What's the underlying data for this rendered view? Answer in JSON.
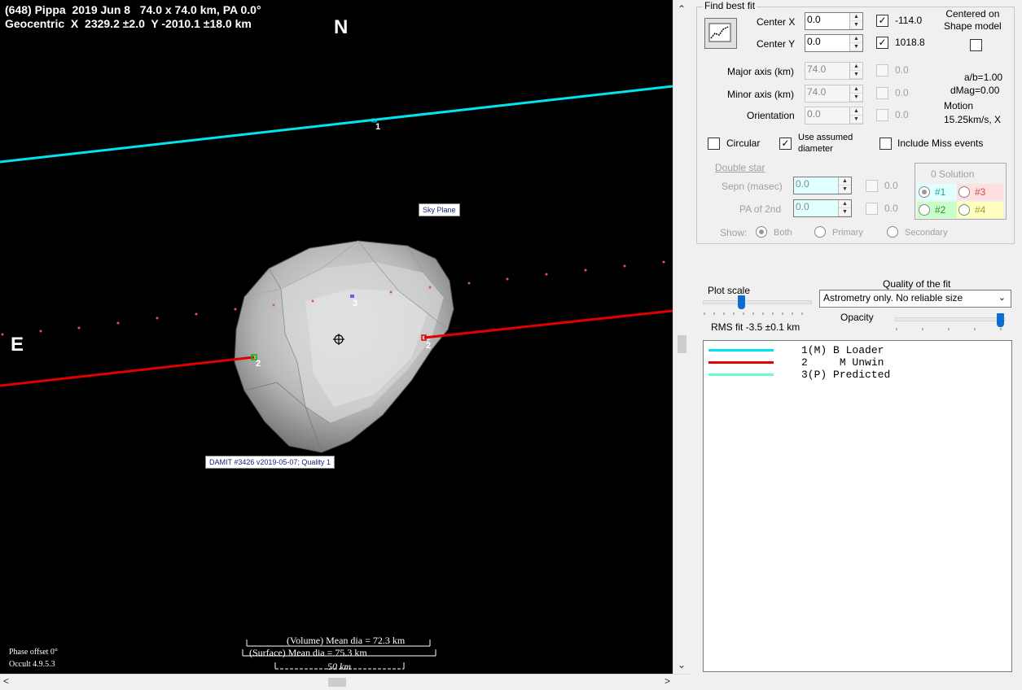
{
  "plot": {
    "header_line1": "(648) Pippa  2019 Jun 8   74.0 x 74.0 km, PA 0.0°",
    "header_line2": "Geocentric  X  2329.2 ±2.0  Y -2010.1 ±18.0 km",
    "north_label": "N",
    "east_label": "E",
    "sky_plane_label": "Sky Plane",
    "model_label": "DAMIT #3426 v2019-05-07; Quality 1",
    "chord_labels": {
      "chord1": "1",
      "chord2_left": "2",
      "chord2_right": "2",
      "chord3": "3"
    },
    "volume_dia": "(Volume) Mean dia = 72.3 km",
    "surface_dia": "(Surface) Mean dia = 75.3 km",
    "scale_label": "50 km",
    "phase_offset": "Phase offset 0°",
    "version": "Occult 4.9.5.3",
    "colors": {
      "chord1": "#00e5ee",
      "chord2": "#e00000",
      "predicted": "#e05070"
    }
  },
  "panel": {
    "find_best_fit": "Find best fit",
    "center_x_label": "Center X",
    "center_x_value": "0.0",
    "center_x_fit": "-114.0",
    "center_y_label": "Center Y",
    "center_y_value": "0.0",
    "center_y_fit": "1018.8",
    "centered_on_shape": "Centered on\nShape model",
    "major_axis_label": "Major axis (km)",
    "major_axis_value": "74.0",
    "major_axis_fit": "0.0",
    "minor_axis_label": "Minor axis (km)",
    "minor_axis_value": "74.0",
    "minor_axis_fit": "0.0",
    "orientation_label": "Orientation",
    "orientation_value": "0.0",
    "orientation_fit": "0.0",
    "ab_ratio": "a/b=1.00",
    "dmag": "dMag=0.00",
    "motion_label": "Motion",
    "motion_value": "15.25km/s, X",
    "circular_label": "Circular",
    "use_assumed_label": "Use assumed\ndiameter",
    "include_miss_label": "Include Miss events",
    "double_star_label": "Double star",
    "sepn_label": "Sepn (masec)",
    "sepn_value": "0.0",
    "sepn_fit": "0.0",
    "pa2_label": "PA of 2nd",
    "pa2_value": "0.0",
    "pa2_fit": "0.0",
    "solution_label": "0 Solution",
    "sol1": "#1",
    "sol2": "#2",
    "sol3": "#3",
    "sol4": "#4",
    "show_label": "Show:",
    "show_both": "Both",
    "show_primary": "Primary",
    "show_secondary": "Secondary",
    "plot_scale_label": "Plot scale",
    "quality_label": "Quality of the fit",
    "quality_value": "Astrometry only. No reliable size",
    "opacity_label": "Opacity",
    "rms_fit": "RMS fit -3.5 ±0.1 km",
    "plot_scale_level": 0.35,
    "opacity_level": 1.0
  },
  "legend": [
    {
      "num": "1(M)",
      "name": "B Loader",
      "color": "#00e5ee"
    },
    {
      "num": "2   ",
      "name": "M Unwin",
      "color": "#e00000"
    },
    {
      "num": "3(P)",
      "name": "Predicted",
      "color": "#66ffcc"
    }
  ]
}
